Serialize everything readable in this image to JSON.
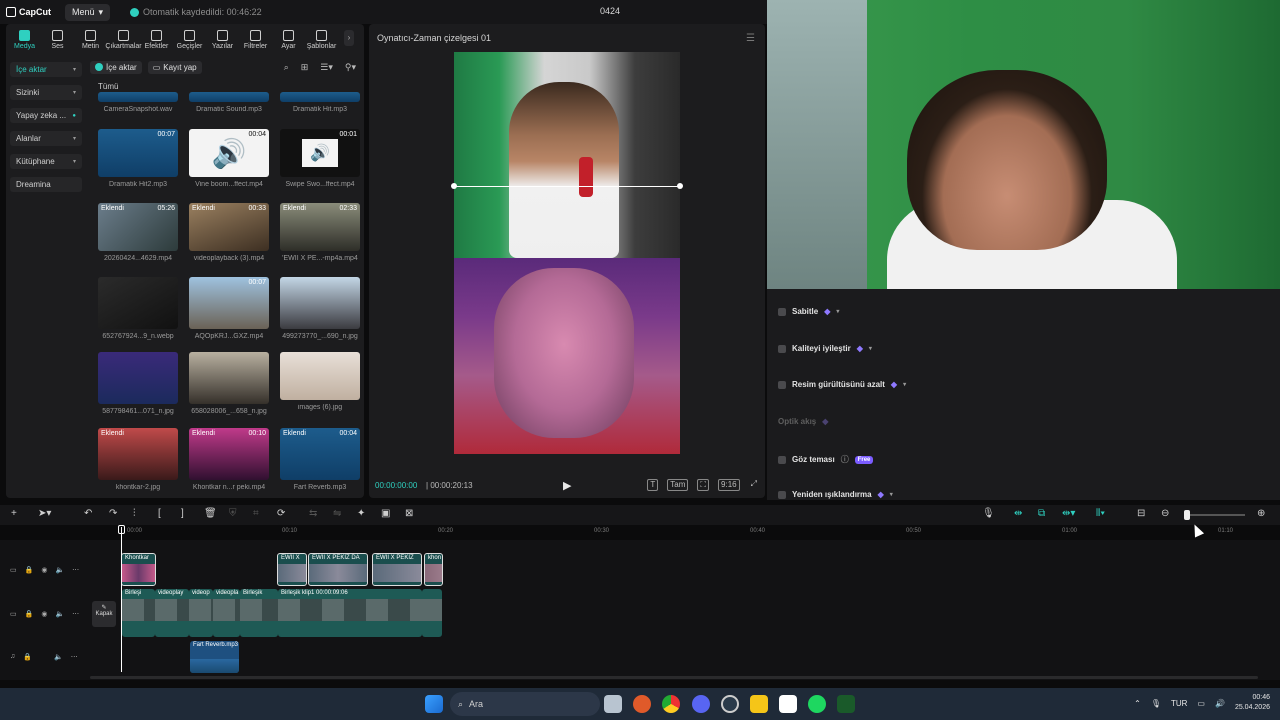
{
  "app": {
    "logo_text": "CapCut",
    "menu_label": "Menü",
    "autosave_text": "Otomatik kaydedildi: 00:46:22",
    "project_title": "0424"
  },
  "tabs": [
    {
      "label": "Medya"
    },
    {
      "label": "Ses"
    },
    {
      "label": "Metin"
    },
    {
      "label": "Çıkartmalar"
    },
    {
      "label": "Efektler"
    },
    {
      "label": "Geçişler"
    },
    {
      "label": "Yazılar"
    },
    {
      "label": "Filtreler"
    },
    {
      "label": "Ayar"
    },
    {
      "label": "Şablonlar"
    }
  ],
  "sidebar": [
    {
      "label": "İçe aktar"
    },
    {
      "label": "Sizinki"
    },
    {
      "label": "Yapay zeka ..."
    },
    {
      "label": "Alanlar"
    },
    {
      "label": "Kütüphane"
    },
    {
      "label": "Dreamina"
    }
  ],
  "media": {
    "import_btn": "İçe aktar",
    "record_btn": "Kayıt yap",
    "all_label": "Tümü",
    "items": [
      {
        "name": "CameraSnapshot.wav",
        "duration": "",
        "badge": ""
      },
      {
        "name": "Dramatic Sound.mp3",
        "duration": "",
        "badge": ""
      },
      {
        "name": "Dramatik Hit.mp3",
        "duration": "",
        "badge": ""
      },
      {
        "name": "Dramatik Hit2.mp3",
        "duration": "00:07",
        "badge": ""
      },
      {
        "name": "Vine boom...ffect.mp4",
        "duration": "00:04",
        "badge": ""
      },
      {
        "name": "Swipe Swo...ffect.mp4",
        "duration": "00:01",
        "badge": ""
      },
      {
        "name": "20260424...4629.mp4",
        "duration": "05:26",
        "badge": "Eklendi"
      },
      {
        "name": "videoplayback (3).mp4",
        "duration": "00:33",
        "badge": "Eklendi"
      },
      {
        "name": "'EWII X PE...-mp4a.mp4",
        "duration": "02:33",
        "badge": "Eklendi"
      },
      {
        "name": "652767924...9_n.webp",
        "duration": "",
        "badge": ""
      },
      {
        "name": "AQOpKRJ...GXZ.mp4",
        "duration": "00:07",
        "badge": ""
      },
      {
        "name": "499273770_...690_n.jpg",
        "duration": "",
        "badge": ""
      },
      {
        "name": "587798461...071_n.jpg",
        "duration": "",
        "badge": ""
      },
      {
        "name": "658028006_...658_n.jpg",
        "duration": "",
        "badge": ""
      },
      {
        "name": "images (6).jpg",
        "duration": "",
        "badge": ""
      },
      {
        "name": "khontkar-2.jpg",
        "duration": "",
        "badge": "Eklendi"
      },
      {
        "name": "Khontkar n...r peki.mp4",
        "duration": "00:10",
        "badge": "Eklendi"
      },
      {
        "name": "Fart Reverb.mp3",
        "duration": "00:04",
        "badge": "Eklendi"
      }
    ]
  },
  "player": {
    "title": "Oynatıcı-Zaman çizelgesi 01",
    "current_time": "00:00:00:00",
    "total_time": "00:00:20:13",
    "btn_full": "Tam",
    "btn_ratio": "9:16"
  },
  "properties": {
    "rows": [
      {
        "label": "Sabitle"
      },
      {
        "label": "Kaliteyi iyileştir"
      },
      {
        "label": "Resim gürültüsünü azalt"
      },
      {
        "label": "Optik akış"
      },
      {
        "label": "Göz teması",
        "badge": "Free"
      },
      {
        "label": "Yeniden ışıklandırma"
      }
    ]
  },
  "timeline": {
    "ruler": [
      "00:00",
      "00:10",
      "00:20",
      "00:30",
      "00:40",
      "00:50",
      "01:00",
      "01:10"
    ],
    "kapak_label": "Kapak",
    "clips_overlay": [
      {
        "label": "Khontkar"
      },
      {
        "label": "EWII X"
      },
      {
        "label": "EWII X PEKİZ  DA"
      },
      {
        "label": "EWII X PEKİZ"
      },
      {
        "label": "khon"
      }
    ],
    "clips_main": [
      {
        "label": "Birleşi"
      },
      {
        "label": "videoplay"
      },
      {
        "label": "videop"
      },
      {
        "label": "videopla"
      },
      {
        "label": "Birleşik"
      },
      {
        "label": "Birleşik klip1   00:00:09:06"
      },
      {
        "label": ""
      }
    ],
    "clip_audio": {
      "label": "Fart Reverb.mp3"
    }
  },
  "taskbar": {
    "search_placeholder": "Ara",
    "lang": "TUR",
    "time": "00:46",
    "date": "25.04.2026"
  },
  "colors": {
    "accent": "#2fd0c0",
    "premium": "#8f79ff"
  }
}
